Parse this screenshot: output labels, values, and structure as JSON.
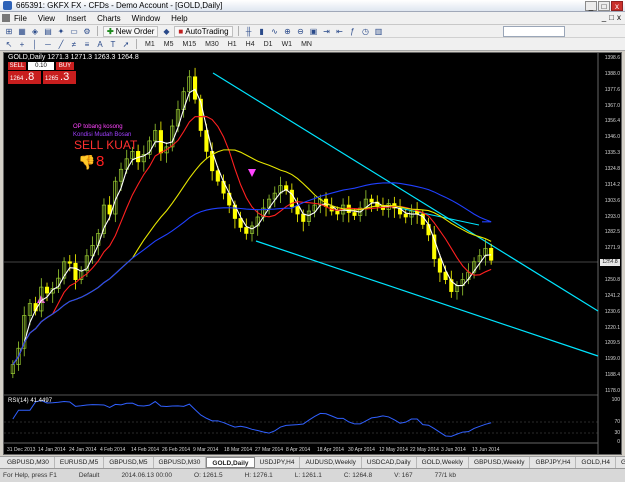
{
  "window": {
    "title": "665391: GKFX FX - CFDs - Demo Account - [GOLD,Daily]",
    "buttons": {
      "minimize": "_",
      "maximize": "□",
      "close": "x"
    }
  },
  "menu": [
    "File",
    "View",
    "Insert",
    "Charts",
    "Window",
    "Help"
  ],
  "mdi_buttons": [
    "_",
    "□",
    "x"
  ],
  "toolbar": {
    "new_order": "New Order",
    "autotrading": "AutoTrading",
    "timeframes": [
      "M1",
      "M5",
      "M15",
      "M30",
      "H1",
      "H4",
      "D1",
      "W1",
      "MN"
    ]
  },
  "chart": {
    "info_line": "GOLD,Daily  1271.3 1271.3 1263.3 1264.8",
    "trade_panel": {
      "sell_label": "SELL",
      "buy_label": "BUY",
      "lot": "0.10",
      "sell_price_small": "1264",
      "sell_price_big": ".8",
      "buy_price_small": "1265",
      "buy_price_big": ".3"
    },
    "annotations": {
      "line1": "OP tobang kosong",
      "line2": "Kondisi Mudah Bosan",
      "sell_kuat": "SELL KUAT",
      "sell_number": "8"
    },
    "rsi_label": "RSI(14) 41.4497",
    "current_price": "1264.8",
    "colors": {
      "background": "#000000",
      "bull_candle": "#9acd32",
      "bear_candle": "#ffff00",
      "ma_white": "#ffffff",
      "ma_red": "#ff2020",
      "ma_yellow": "#e6e600",
      "ma_blue": "#2040ff",
      "channel": "#00e5ff",
      "rsi_line": "#3060ff"
    },
    "price_axis_labels": [
      "1398.6",
      "1388.0",
      "1377.6",
      "1367.0",
      "1356.4",
      "1346.0",
      "1335.3",
      "1324.8",
      "1314.2",
      "1303.6",
      "1293.0",
      "1282.5",
      "1271.9",
      "1261.3",
      "1250.8",
      "1241.2",
      "1230.6",
      "1220.1",
      "1209.5",
      "1199.0",
      "1188.4",
      "1178.0"
    ],
    "rsi_axis_labels": [
      "100",
      "70",
      "30",
      "0"
    ],
    "date_axis_labels": [
      "31 Dec 2013",
      "14 Jan 2014",
      "24 Jan 2014",
      "4 Feb 2014",
      "14 Feb 2014",
      "26 Feb 2014",
      "9 Mar 2014",
      "18 Mar 2014",
      "27 Mar 2014",
      "8 Apr 2014",
      "18 Apr 2014",
      "30 Apr 2014",
      "12 May 2014",
      "22 May 2014",
      "3 Jun 2014",
      "13 Jun 2014"
    ]
  },
  "chart_data": {
    "type": "candlestick",
    "symbol": "GOLD",
    "timeframe": "Daily",
    "x_range": [
      "31 Dec 2013",
      "13 Jun 2014"
    ],
    "ylim": [
      1178.0,
      1398.6
    ],
    "close_path": [
      1195,
      1206,
      1228,
      1236,
      1231,
      1247,
      1243,
      1246,
      1253,
      1264,
      1263,
      1252,
      1258,
      1268,
      1275,
      1283,
      1302,
      1296,
      1318,
      1326,
      1333,
      1338,
      1331,
      1336,
      1345,
      1352,
      1337,
      1341,
      1355,
      1366,
      1378,
      1388,
      1373,
      1352,
      1338,
      1325,
      1318,
      1310,
      1302,
      1293,
      1287,
      1283,
      1288,
      1294,
      1300,
      1306,
      1310,
      1315,
      1312,
      1301,
      1296,
      1291,
      1298,
      1302,
      1306,
      1301,
      1298,
      1296,
      1302,
      1297,
      1295,
      1300,
      1306,
      1304,
      1301,
      1299,
      1303,
      1300,
      1296,
      1294,
      1298,
      1296,
      1289,
      1282,
      1266,
      1257,
      1252,
      1244,
      1248,
      1252,
      1257,
      1264,
      1268,
      1273,
      1265
    ],
    "annotation_texts": [
      "OP tobang kosong",
      "Kondisi Mudah Bosan",
      "SELL KUAT"
    ],
    "rsi": {
      "name": "RSI(14)",
      "last": 41.4497,
      "levels": [
        70,
        30
      ],
      "ylim": [
        0,
        100
      ]
    }
  },
  "tabs": [
    "GBPUSD,M30",
    "EURUSD,M5",
    "GBPUSD,M5",
    "GBPUSD,M30",
    "GOLD,Daily",
    "USDJPY,H4",
    "AUDUSD,Weekly",
    "USDCAD,Daily",
    "GOLD,Weekly",
    "GBPUSD,Weekly",
    "GBPJPY,H4",
    "GOLD,H4",
    "GBPJPY,H4",
    "EURGBP,M5",
    "GBPUSD,M5"
  ],
  "active_tab": "GOLD,Daily",
  "status": {
    "help": "For Help, press F1",
    "profile": "Default",
    "datetime": "2014.06.13 00:00",
    "open": "O: 1261.5",
    "high": "H: 1276.1",
    "low": "L: 1261.1",
    "close": "C: 1264.8",
    "volume": "V: 167",
    "traffic": "77/1 kb"
  }
}
